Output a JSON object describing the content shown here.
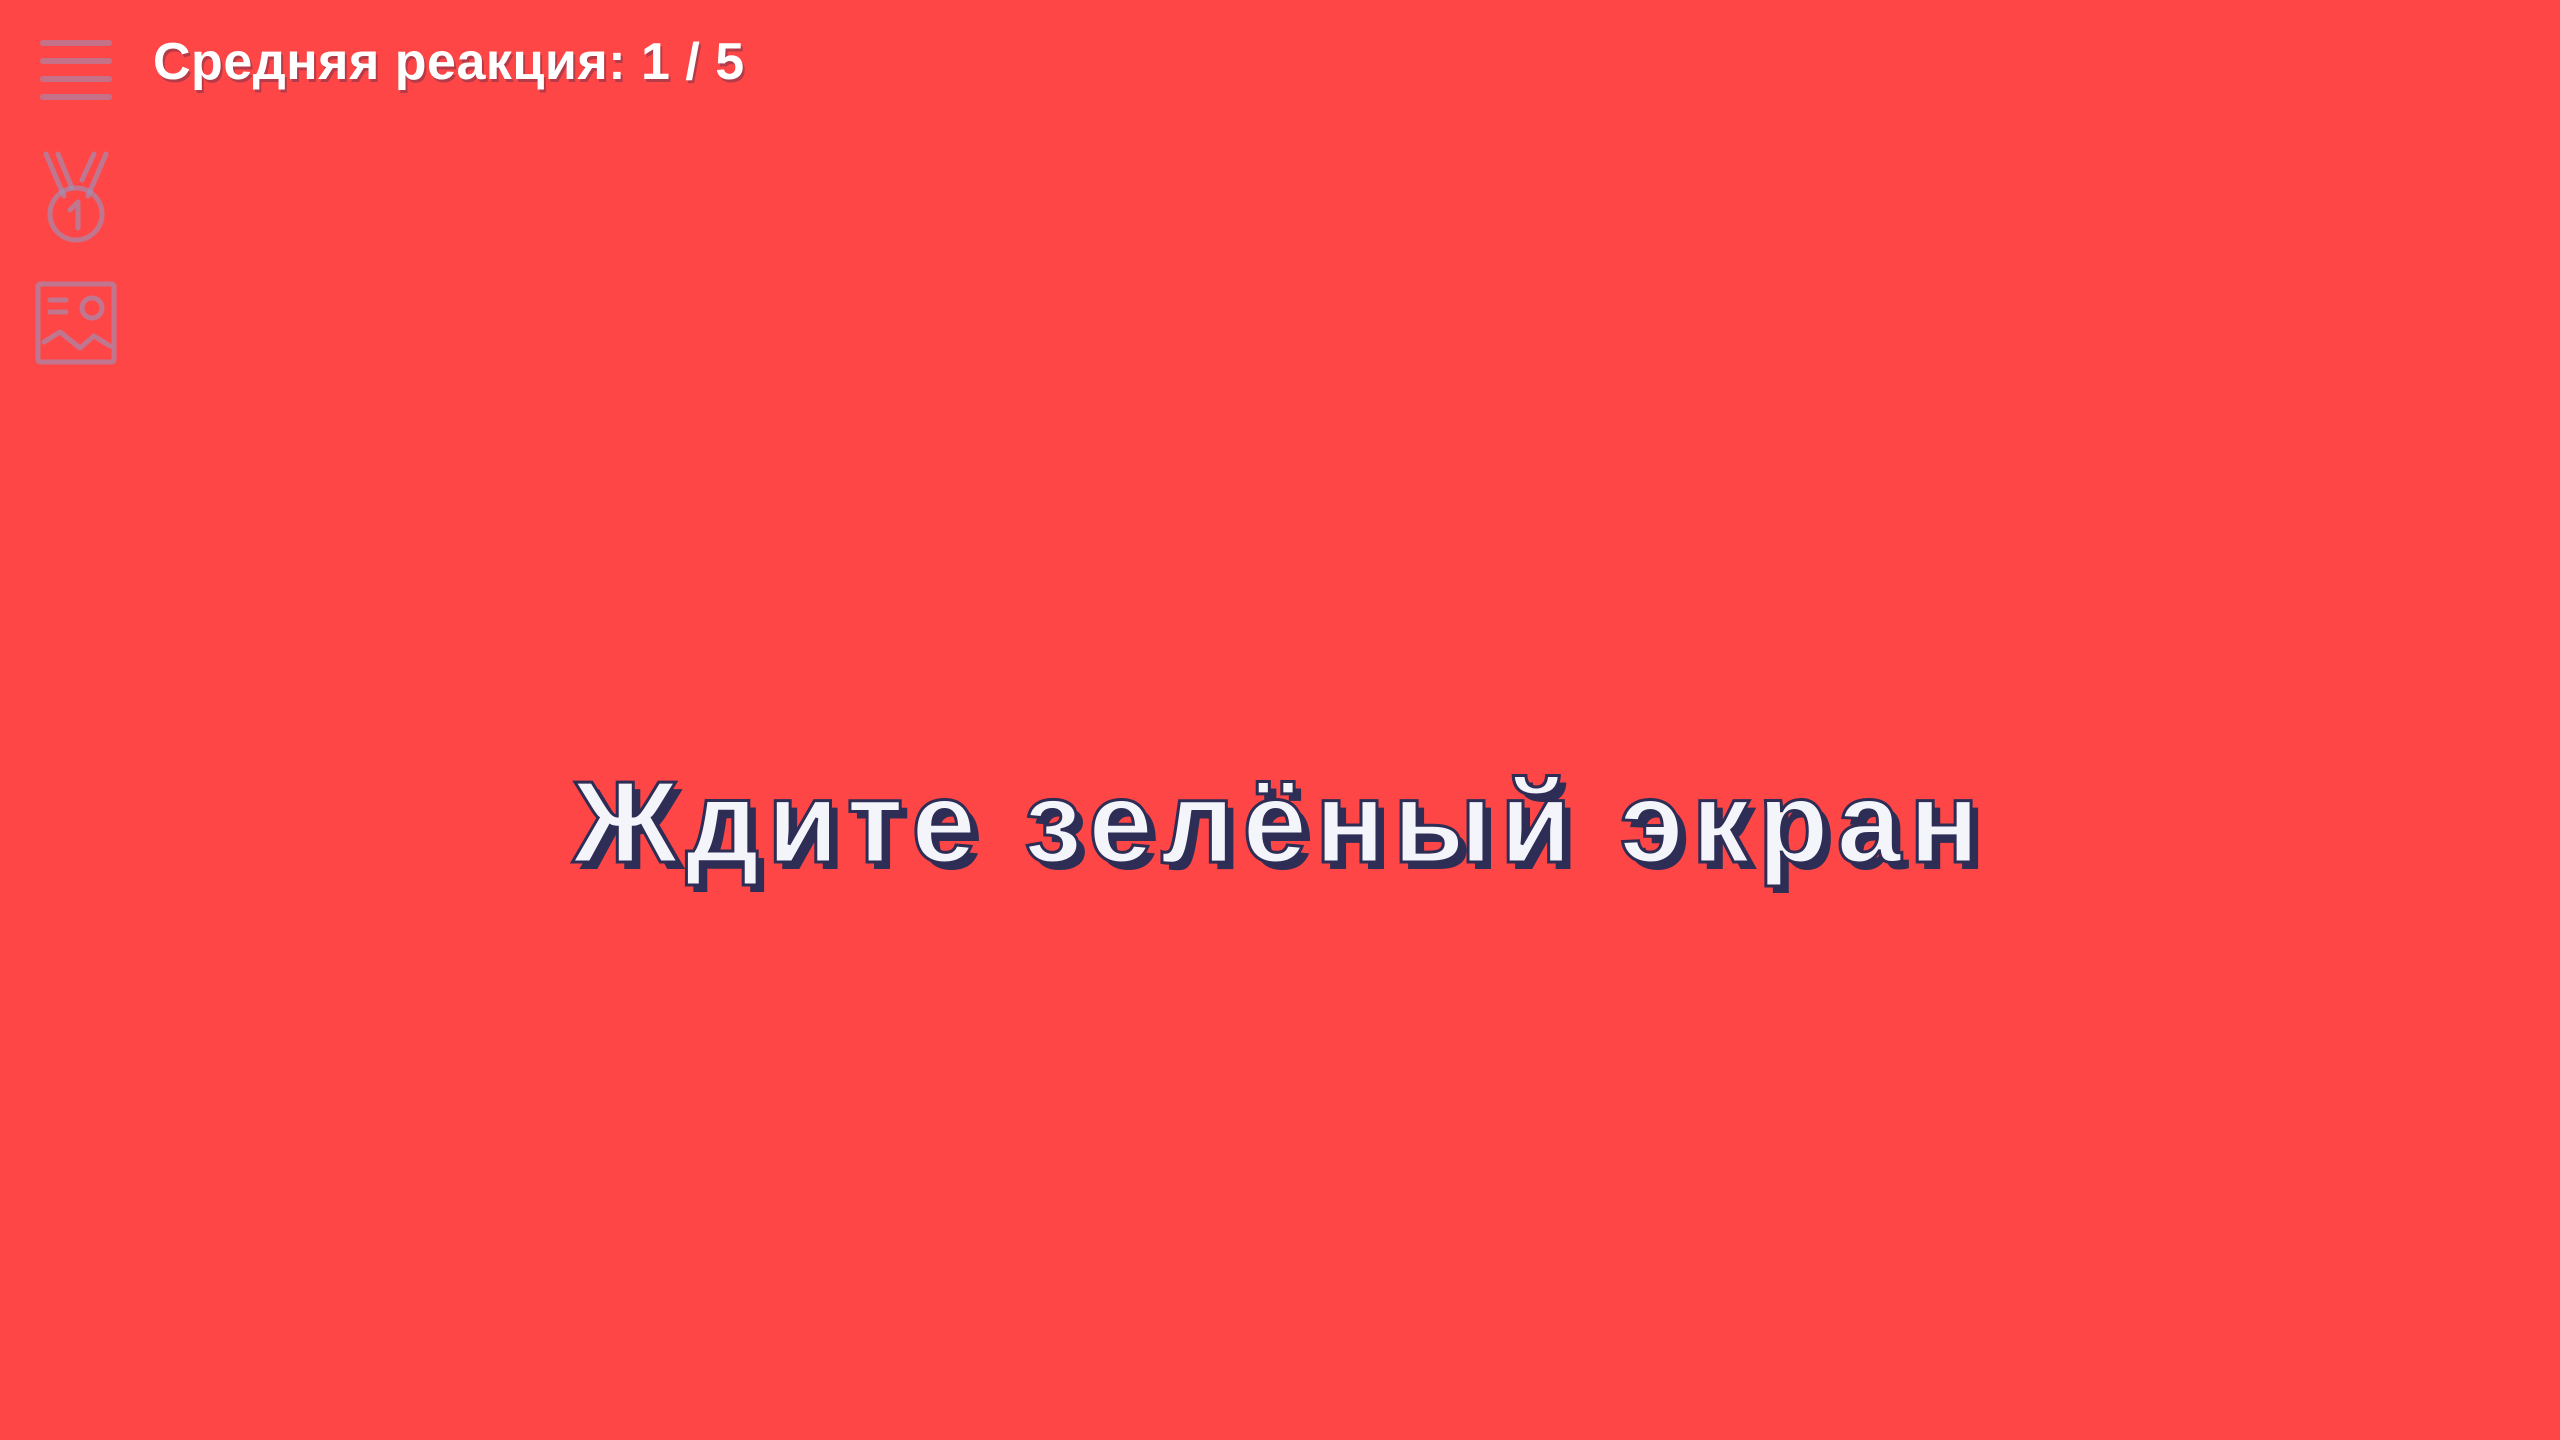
{
  "theme": {
    "background": "#ff4646",
    "icon_color": "#9696be",
    "text_color": "#ffffff",
    "outline_color": "#2d2d55"
  },
  "header": {
    "status": "Средняя реакция: 1 / 5"
  },
  "toolbar": {
    "icons": [
      "menu-icon",
      "medal-icon",
      "image-gallery-icon"
    ]
  },
  "main": {
    "prompt": "Ждите зелёный экран"
  }
}
